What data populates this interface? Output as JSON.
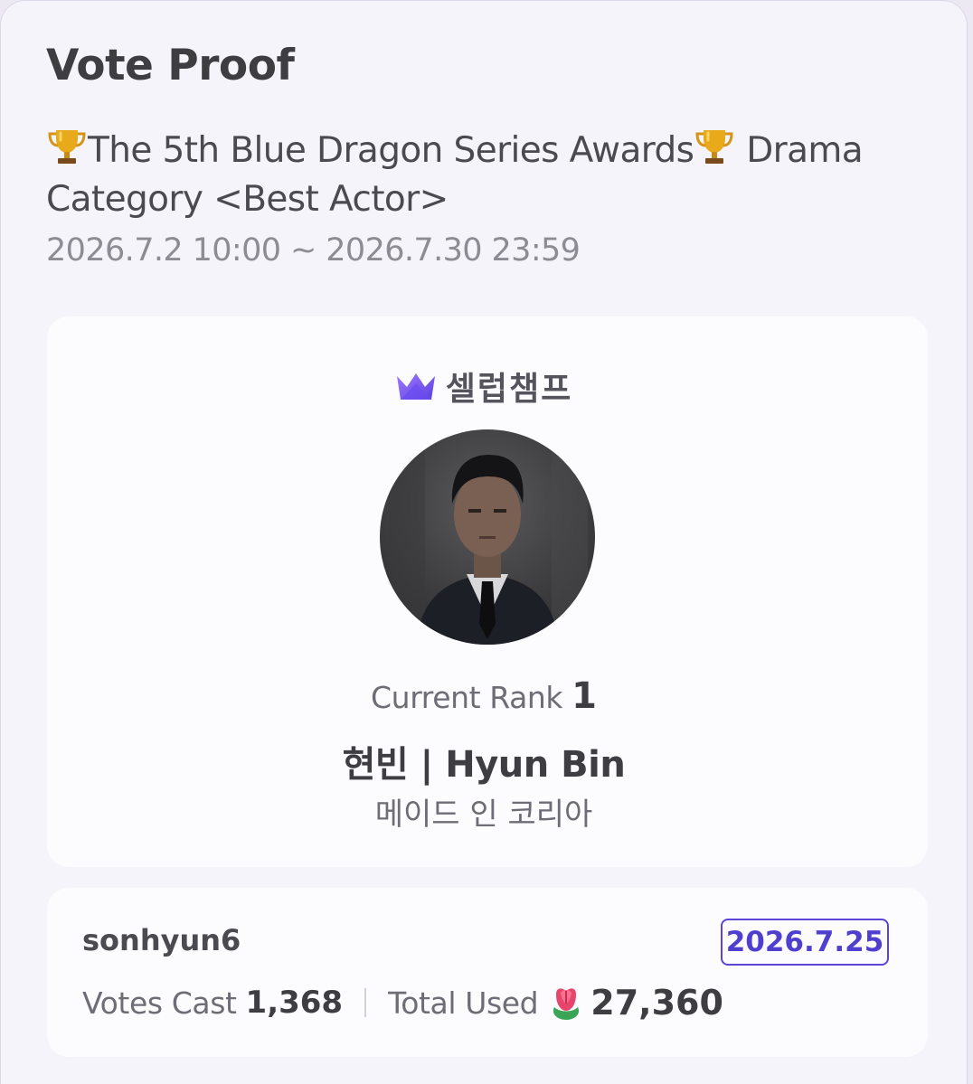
{
  "header": {
    "title": "Vote Proof"
  },
  "event": {
    "title_prefix": "The 5th Blue Dragon Series Awards",
    "title_suffix": " Drama Category <Best Actor>",
    "period": "2026.7.2 10:00 ~ 2026.7.30 23:59",
    "icon": "trophy-icon"
  },
  "candidate_card": {
    "brand": "셀럽챔프",
    "brand_icon": "crown-icon",
    "rank_label": "Current Rank",
    "rank_value": "1",
    "artist_name": "현빈 | Hyun Bin",
    "work_title": "메이드 인 코리아"
  },
  "vote_card": {
    "username": "sonhyun6",
    "date": "2026.7.25",
    "votes_label": "Votes Cast",
    "votes_value": "1,368",
    "total_label": "Total Used",
    "total_value": "27,360",
    "currency_icon": "rose-icon"
  },
  "colors": {
    "accent": "#5b45d6",
    "background": "#f6f4fb",
    "card": "#fcfbfe"
  }
}
